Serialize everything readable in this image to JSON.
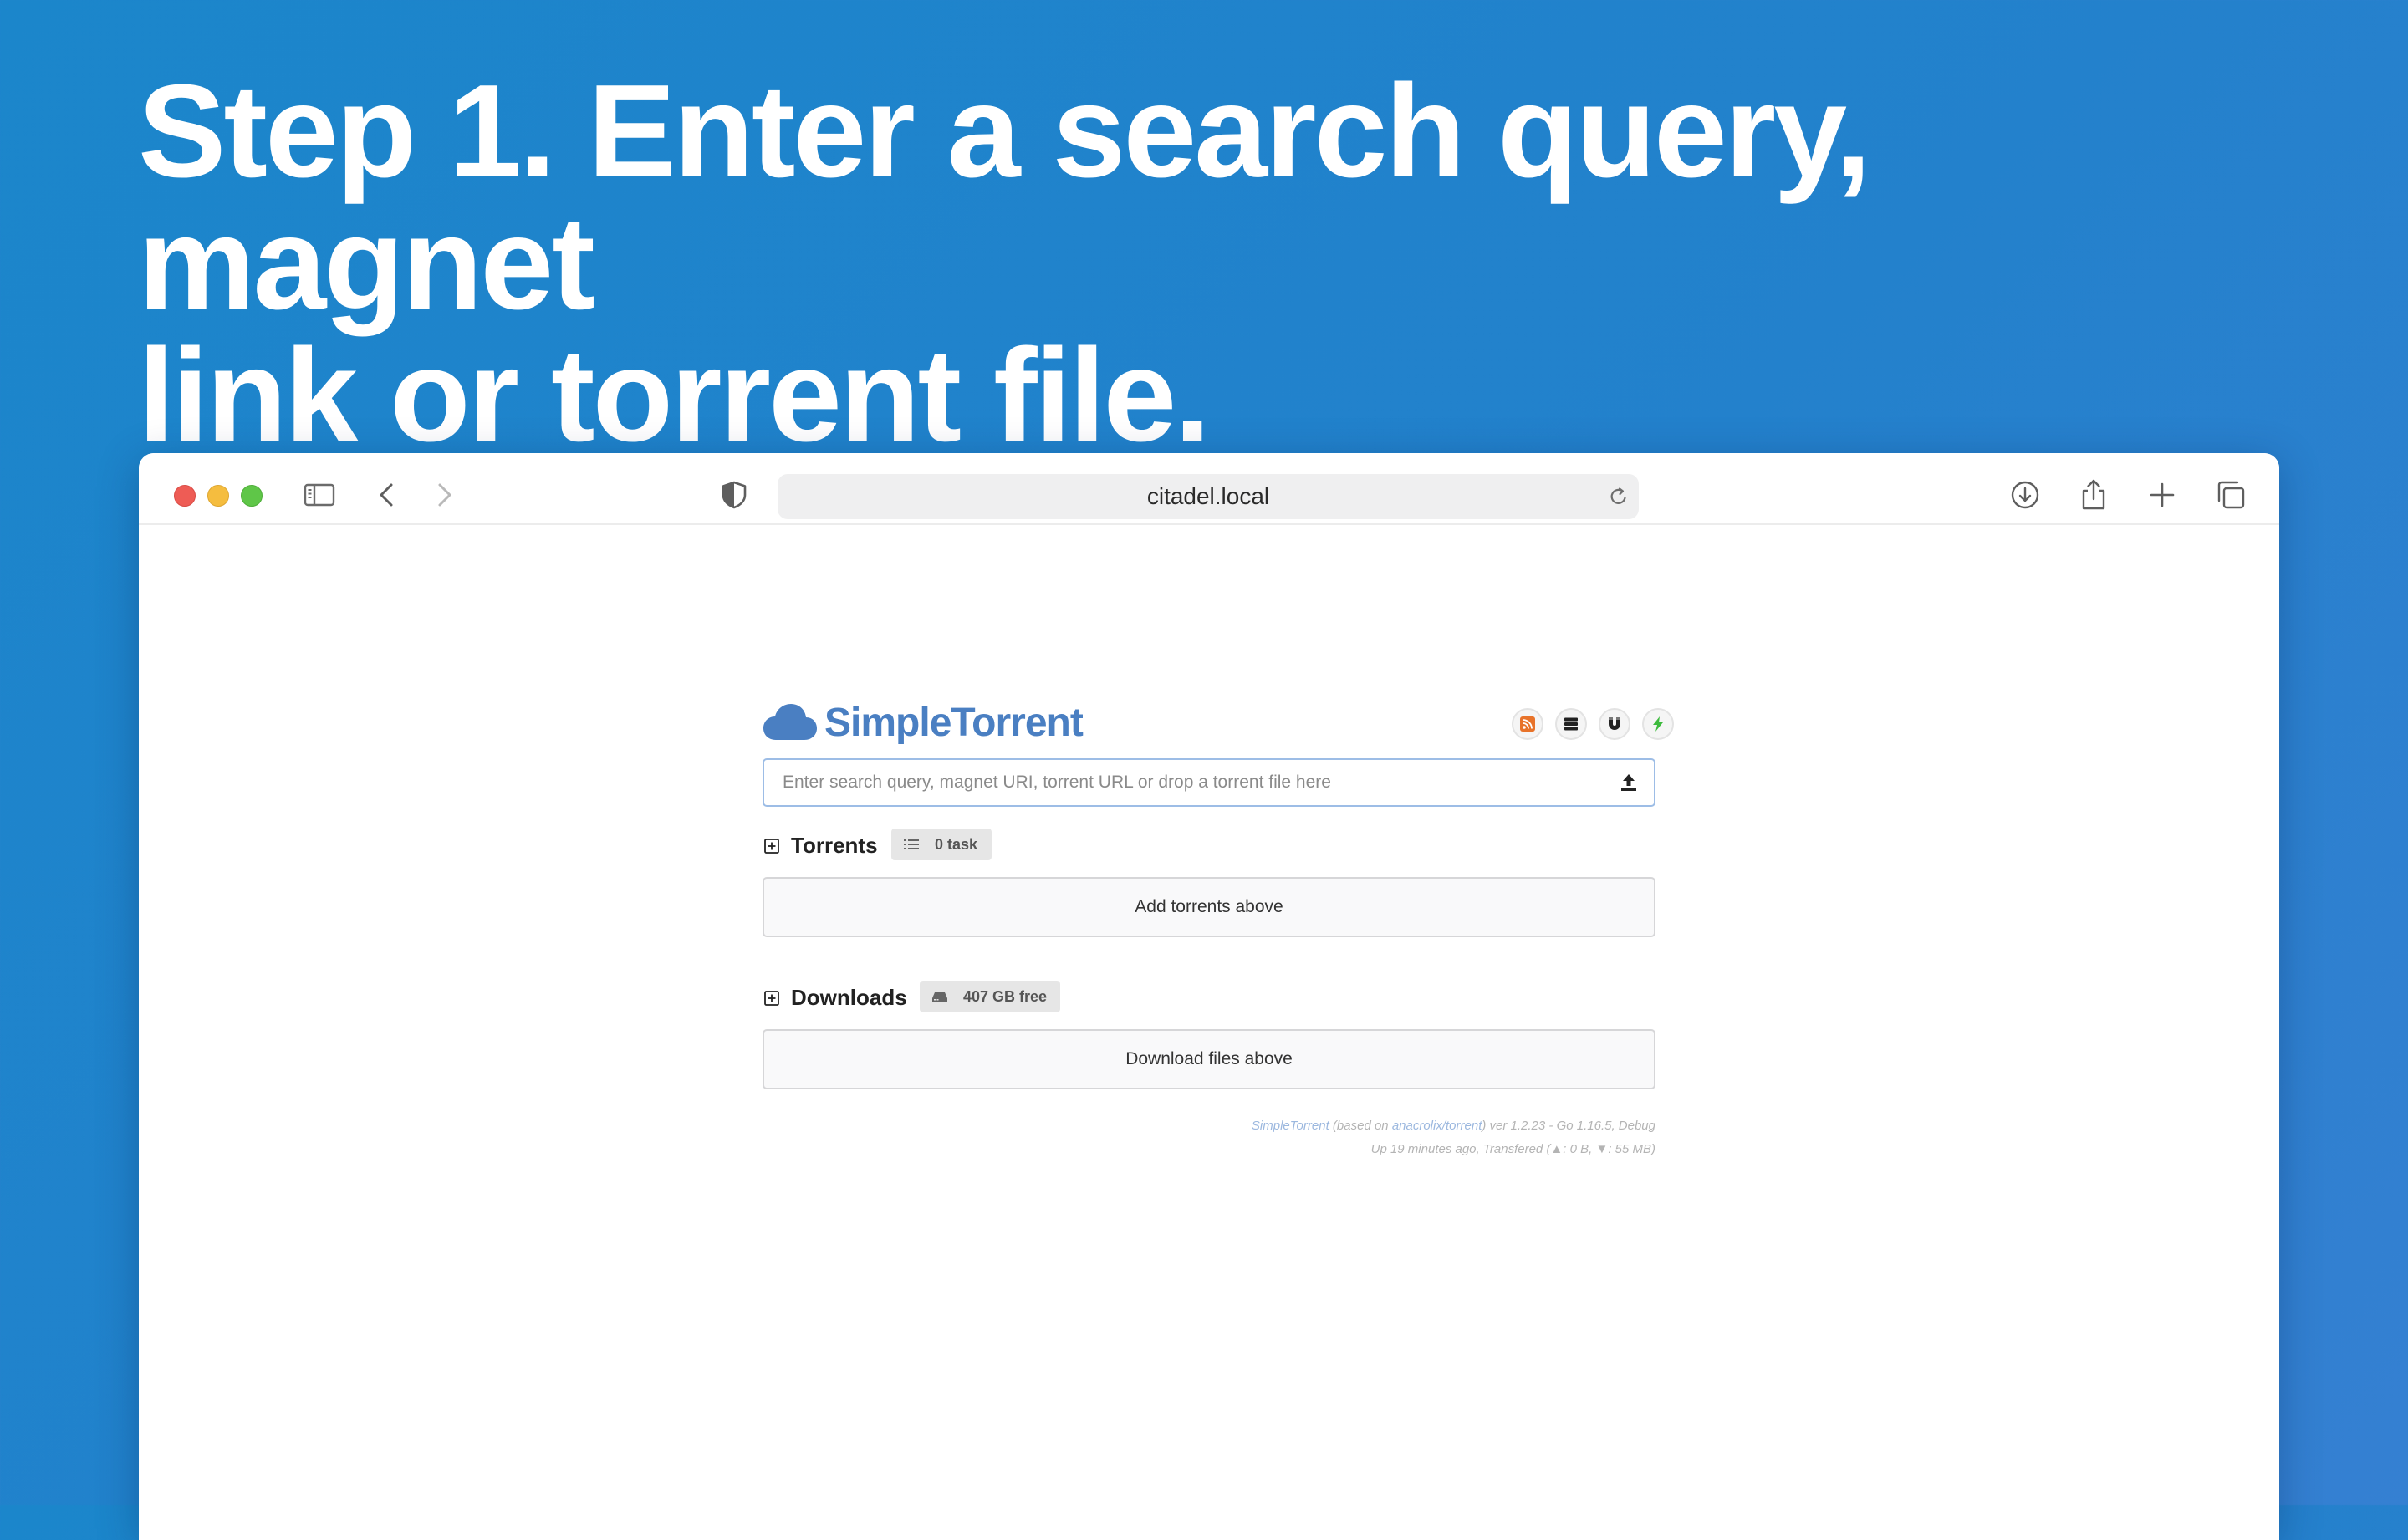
{
  "headline": {
    "line1": "Step 1. Enter a search query, magnet",
    "line2": "link or torrent file."
  },
  "browser": {
    "url": "citadel.local",
    "icons": {
      "sidebar": "sidebar-icon",
      "back": "chevron-left-icon",
      "forward": "chevron-right-icon",
      "privacy": "shield-icon",
      "reload": "reload-icon",
      "downloads": "download-icon",
      "share": "share-icon",
      "new_tab": "plus-icon",
      "tabs": "tabs-overview-icon"
    }
  },
  "app": {
    "name": "SimpleTorrent",
    "brand_color": "#4a7fc2",
    "search": {
      "placeholder": "Enter search query, magnet URI, torrent URL or drop a torrent file here",
      "value": ""
    },
    "top_buttons": [
      {
        "icon": "rss-icon",
        "color": "#e8732a"
      },
      {
        "icon": "server-icon",
        "color": "#222222"
      },
      {
        "icon": "magnet-icon",
        "color": "#222222"
      },
      {
        "icon": "bolt-icon",
        "color": "#3dbb3d"
      }
    ],
    "torrents": {
      "title": "Torrents",
      "badge": "0 task",
      "empty_text": "Add torrents above"
    },
    "downloads": {
      "title": "Downloads",
      "badge": "407 GB free",
      "empty_text": "Download files above"
    },
    "footer": {
      "app_link": "SimpleTorrent",
      "based_on_prefix": "(based on",
      "based_on_link": "anacrolix/torrent",
      "version_info": ") ver 1.2.23 - Go 1.16.5, Debug",
      "uptime": "Up 19 minutes ago, Transfered (▲: 0 B, ▼: 55 MB)"
    }
  }
}
